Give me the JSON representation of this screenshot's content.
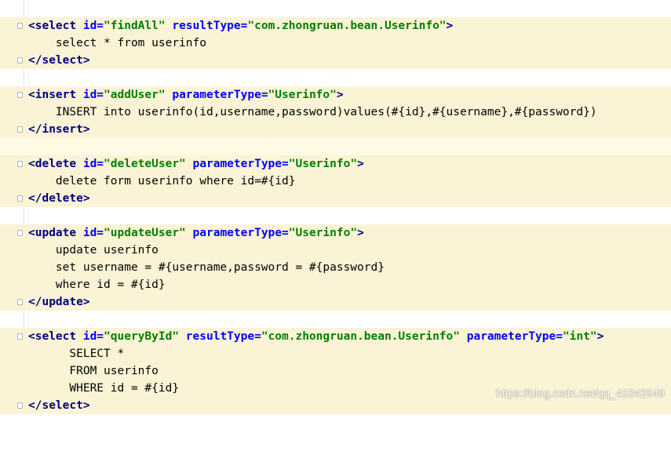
{
  "lines": {
    "l1": {
      "open": "<select",
      "a1": " id=",
      "v1": "\"findAll\"",
      "a2": " resultType=",
      "v2": "\"com.zhongruan.bean.Userinfo\"",
      "close": ">"
    },
    "l2": {
      "text": "    select * from userinfo"
    },
    "l3": {
      "text": "</select>"
    },
    "l5": {
      "open": "<insert",
      "a1": " id=",
      "v1": "\"addUser\"",
      "a2": " parameterType=",
      "v2": "\"Userinfo\"",
      "close": ">"
    },
    "l6": {
      "text": "    INSERT into userinfo(id,username,password)values(#{id},#{username},#{password})"
    },
    "l7": {
      "text": "</insert>"
    },
    "l9": {
      "open": "<delete",
      "a1": " id=",
      "v1": "\"deleteUser\"",
      "a2": " parameterType=",
      "v2": "\"Userinfo\"",
      "close": ">"
    },
    "l10": {
      "text": "    delete form userinfo where id=#{id}"
    },
    "l11": {
      "text": "</delete>"
    },
    "l13": {
      "open": "<update",
      "a1": " id=",
      "v1": "\"updateUser\"",
      "a2": " parameterType=",
      "v2": "\"Userinfo\"",
      "close": ">"
    },
    "l14": {
      "text": "    update userinfo"
    },
    "l15": {
      "text": "    set username = #{username,password = #{password}"
    },
    "l16": {
      "text": "    where id = #{id}"
    },
    "l17": {
      "text": "</update>"
    },
    "l19": {
      "open": "<select",
      "a1": " id=",
      "v1": "\"queryById\"",
      "a2": " resultType=",
      "v2": "\"com.zhongruan.bean.Userinfo\"",
      "a3": " parameterType=",
      "v3": "\"int\"",
      "close": ">"
    },
    "l20": {
      "text": "      SELECT *"
    },
    "l21": {
      "text": "      FROM userinfo"
    },
    "l22": {
      "text": "      WHERE id = #{id}"
    },
    "l23": {
      "text": "</select>"
    }
  },
  "watermark": "https://blog.csdn.net/qq_41042949",
  "colors": {
    "tag": "#000080",
    "attribute": "#0000ff",
    "value": "#008000",
    "highlight": "#fbf3d6"
  }
}
